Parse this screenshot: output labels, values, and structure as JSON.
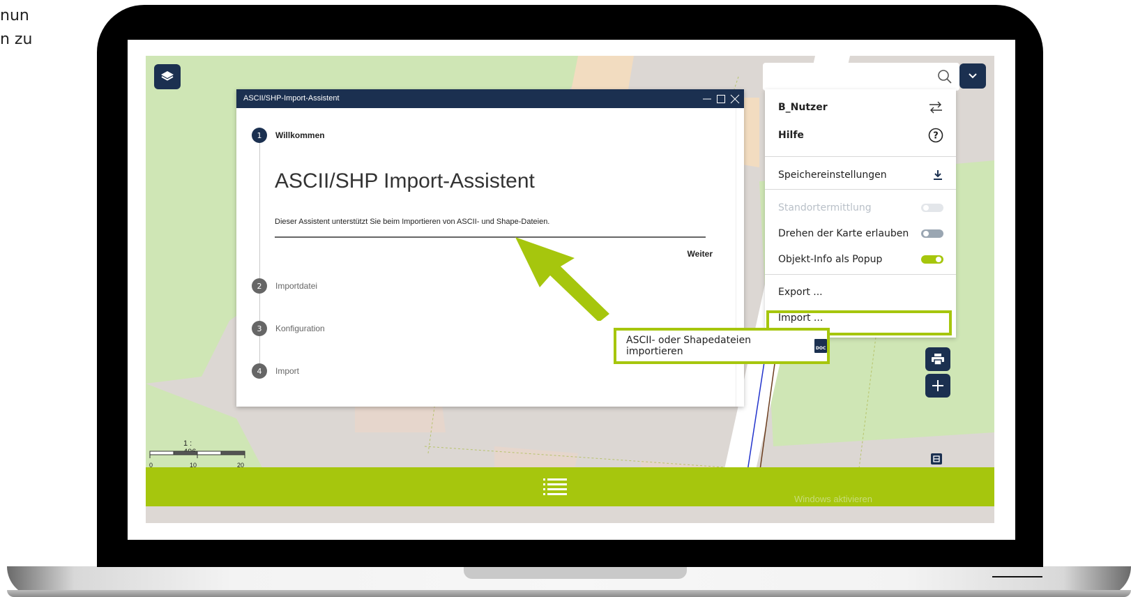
{
  "background_text": {
    "line1": "nun",
    "line2": "n zu"
  },
  "wizard": {
    "title": "ASCII/SHP-Import-Assistent",
    "heading": "ASCII/SHP Import-Assistent",
    "description": "Dieser Assistent unterstützt Sie beim Importieren von ASCII- und Shape-Dateien.",
    "next_label": "Weiter",
    "steps": [
      {
        "num": "1",
        "label": "Willkommen"
      },
      {
        "num": "2",
        "label": "Importdatei"
      },
      {
        "num": "3",
        "label": "Konfiguration"
      },
      {
        "num": "4",
        "label": "Import"
      }
    ]
  },
  "menu": {
    "user": "B_Nutzer",
    "help": "Hilfe",
    "save_settings": "Speichereinstellungen",
    "location": "Standortermittlung",
    "rotate": "Drehen der Karte erlauben",
    "popup": "Objekt-Info als Popup",
    "export": "Export ...",
    "import": "Import ..."
  },
  "toggles": {
    "location": false,
    "rotate": false,
    "popup": true
  },
  "callout": {
    "label": "ASCII- oder Shapedateien importieren",
    "doc_icon_text": "DOC"
  },
  "scalebar": {
    "scale": "1 : 406",
    "ticks": [
      "0",
      "10 m",
      "20 m"
    ]
  },
  "watermark": "Windows aktivieren",
  "icons": {
    "layers": "layers-icon",
    "search": "search-icon",
    "chevron": "chevron-down-icon",
    "print": "print-icon",
    "plus": "plus-icon",
    "list": "list-icon",
    "swap": "swap-arrows-icon",
    "help": "question-circle-icon",
    "download": "download-icon",
    "doc": "doc-file-icon",
    "legend": "legend-icon"
  },
  "colors": {
    "navy": "#1b3050",
    "accent_green": "#a6c60d"
  }
}
